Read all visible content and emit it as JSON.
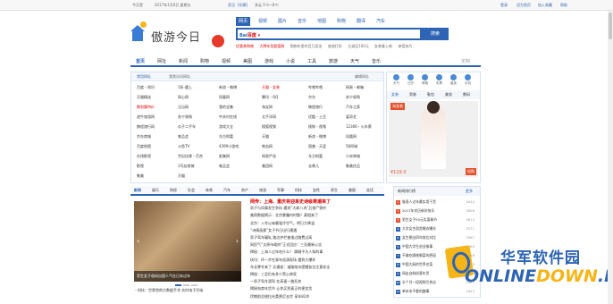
{
  "topbar": {
    "greeting": "今天是",
    "date": "2017年1月6日 星期五",
    "city": "武汉",
    "change_city": "[切换]",
    "weather": "多云 5℃~8℃",
    "links": [
      "登录",
      "设为首页",
      "加入收藏",
      "帮助"
    ]
  },
  "logo": {
    "text": "傲游今日"
  },
  "search": {
    "tabs": [
      "网页",
      "视频",
      "图片",
      "音乐",
      "地图",
      "购物",
      "翻译",
      "汽车"
    ],
    "active_tab": "网页",
    "engine": "百度",
    "placeholder": "",
    "button_label": "搜索",
    "hot_links": [
      "优惠券购物",
      "大牌年货超值购",
      "购物车里的百万奖金",
      "旅游打折",
      "立减至100元",
      "女装春上新",
      "穿搭技巧"
    ]
  },
  "nav": {
    "items": [
      "首页",
      "网址",
      "新闻",
      "购物",
      "视频",
      "美图",
      "游戏",
      "小说",
      "工具",
      "旅游",
      "天气",
      "音乐"
    ],
    "active": "首页",
    "settings": "定制"
  },
  "site_panel": {
    "tabs": [
      "常用网址",
      "我常访问网址"
    ],
    "edit_label": "编辑网址",
    "rows": [
      [
        "百度・知识",
        "1折·遇上",
        "新浪・微博",
        "天猫・女装",
        "哔哩哔哩",
        "网易・邮箱"
      ],
      [
        "天猫精选",
        "网心网",
        "凤凰网",
        "腾讯・QQ",
        "京东",
        "苏宁易购"
      ],
      [
        "聚划算特价",
        "当当网",
        "我的全集",
        "淘宝网",
        "携程旅行",
        "汽车之家"
      ],
      [
        "途牛旅游网",
        "苏宁易购",
        "中关村在线",
        "太平洋网",
        "优酷・土豆",
        "爱奇艺"
      ],
      [
        "携程旅行网",
        "瓜子二手车",
        "游戏大全",
        "搜狐视频",
        "搜狗・视频",
        "12306・火车票"
      ],
      [
        "京东商城",
        "唯品会",
        "东方财富",
        "天猫",
        "新浪・微博",
        "凤凰网"
      ],
      [
        "百度地图",
        "斗鱼TV",
        "4399小游戏",
        "铁血网",
        "国美・天涯",
        "58同城"
      ],
      [
        "在线影视",
        "世纪佳缘・百合",
        "赶集网",
        "网易严选",
        "东方财富",
        "小米商城"
      ],
      [
        "影视",
        "1号店商城",
        "唯品会",
        "美团网",
        "去哪儿",
        "聚美优品"
      ],
      [
        "聚美",
        "天猫",
        "",
        "",
        "",
        ""
      ]
    ]
  },
  "weather_panel": {
    "cells": [
      "天气",
      "日历",
      "邮箱",
      "彩票",
      "星座",
      "手机"
    ],
    "tabs": [
      "女装",
      "男装",
      "鞋包",
      "美妆",
      "数码"
    ],
    "promo": {
      "shop": "淘女装",
      "price": "¥119.0",
      "buy": "抢购"
    }
  },
  "news": {
    "tabs": [
      "新闻",
      "娱乐",
      "财经",
      "社会",
      "体育",
      "汽车",
      "房产",
      "旅游",
      "军事",
      "科技",
      "女性",
      "养生",
      "美图",
      "笑话"
    ],
    "active": "新闻",
    "photo_caption": "男生女子爸妈出国人气在日本过年",
    "items": [
      "网传：上海、重庆将迎来史诗级寒潮来了",
      "男子与同事发生争执 遭其“大卸八块”后抛尸野外",
      "美债数据揭示：北京雾霾何时散？真相来了",
      "北京：入冬以来最强冷空气，明日大降温",
      "“诗情画意”女子节日出行遭遇",
      "男子驾车碾轧 路边护栏被指过路费过高",
      "网民气“太原市政府”正式回应：三亚最新公告",
      "揭秘：上海人过年吃什么？ 聊聊不为人知的事",
      "快讯：环一步在青年巡演现场 遇到大爆炸",
      "东北寒冬来了 交通部：道路结冰提醒各位注意安全",
      "揭秘：三亚仍有多少黑心商家",
      "一男子驾车酒驾 在高速一路狂奔",
      "揭秘电商年货节 让你买到真正的便宜货",
      "伊朗前总统拉夫桑贾尼去世 享年82岁"
    ],
    "below_photo": "・科技：世界首例大数据手术 实时电子开始"
  },
  "hot_list": {
    "title": "新闻排行榜",
    "more": "更多",
    "items": [
      {
        "title": "鲁昌人过年最实用干货",
        "count": "4044"
      },
      {
        "title": "2017年农历新年快乐",
        "count": "3856"
      },
      {
        "title": "男生女子50元实惠春节",
        "count": "3614"
      },
      {
        "title": "大学女生宿舍睡衣曝光",
        "count": "3271"
      },
      {
        "title": "女生晒出四年前后对比",
        "count": "2987"
      },
      {
        "title": "中国大学生创业故事",
        "count": "2764"
      },
      {
        "title": "不敢吃隔夜剩菜的原因",
        "count": "2548"
      },
      {
        "title": "中国大厨的世界名菜",
        "count": "2312"
      },
      {
        "title": "网友自制创意年货",
        "count": "2104"
      },
      {
        "title": "半个月一段视频引热议",
        "count": "1987"
      },
      {
        "title": "单本本不看的趣事",
        "count": "1843"
      }
    ]
  },
  "watermark": {
    "cn": "华军软件园",
    "en_prefix": "ONLINE",
    "en_suffix": "DOWN",
    "domain": ".NET"
  },
  "colors": {
    "accent": "#2d64b3",
    "hot": "#e5532d",
    "gold": "#f6b417"
  }
}
